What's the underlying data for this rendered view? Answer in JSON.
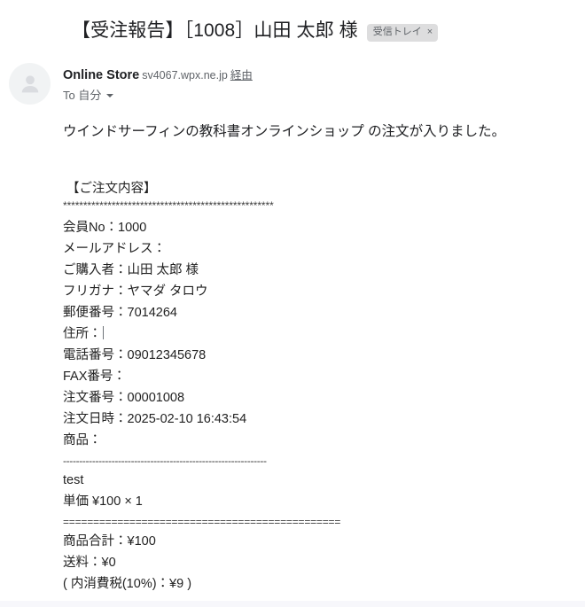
{
  "email": {
    "subject": "【受注報告】［1008］山田 太郎 様",
    "label_chip": {
      "text": "受信トレイ",
      "close_icon": "×"
    },
    "sender": {
      "name": "Online Store",
      "domain": "sv4067.wpx.ne.jp",
      "via": "経由",
      "recipient": "To 自分"
    },
    "body": {
      "intro": "ウインドサーフィンの教科書オンラインショップ の注文が入りました。",
      "order_heading": "【ご注文内容】",
      "rule_asterisks": "****************************************************",
      "details": [
        "会員No：1000",
        "メールアドレス：",
        "ご購入者：山田 太郎 様",
        "フリガナ：ヤマダ タロウ",
        "郵便番号：7014264"
      ],
      "address_label": "住所：",
      "details_after_address": [
        "電話番号：09012345678",
        "FAX番号：",
        "注文番号：00001008",
        "注文日時：2025-02-10 16:43:54",
        "商品："
      ],
      "rule_dashes": "---------------------------------------------------------------",
      "item_name": "test",
      "item_price_line": "単価 ¥100 × 1",
      "rule_equals": "==============================================",
      "totals": [
        "商品合計：¥100",
        "送料：¥0",
        "( 内消費税(10%)：¥9 )"
      ]
    }
  },
  "colors": {
    "chip_background": "#ddddde",
    "chip_text": "#5f6368",
    "avatar_background": "#f1f3f4",
    "text_primary": "#202124",
    "text_secondary": "#5f6368",
    "bottom_strip": "#f7f7fb"
  }
}
